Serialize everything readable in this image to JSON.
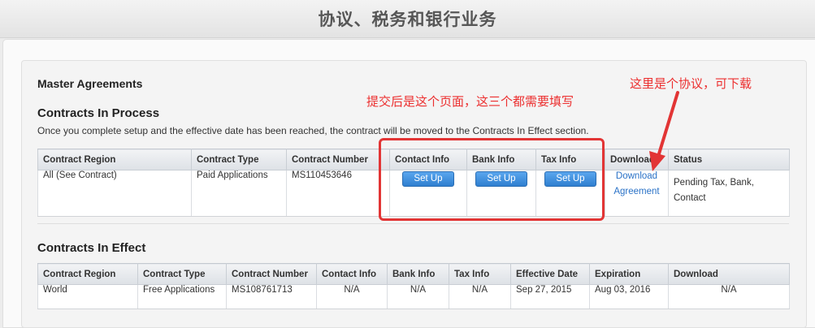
{
  "header": {
    "title": "协议、税务和银行业务"
  },
  "master": {
    "heading": "Master Agreements"
  },
  "in_process": {
    "heading": "Contracts In Process",
    "description": "Once you complete setup and the effective date has been reached, the contract will be moved to the Contracts In Effect section.",
    "columns": [
      "Contract Region",
      "Contract Type",
      "Contract Number",
      "Contact Info",
      "Bank Info",
      "Tax Info",
      "Download",
      "Status"
    ],
    "row": {
      "region": "All (See Contract)",
      "type": "Paid Applications",
      "number": "MS110453646",
      "contact_button": "Set Up",
      "bank_button": "Set Up",
      "tax_button": "Set Up",
      "download_line1": "Download",
      "download_line2": "Agreement",
      "status_line1": "Pending Tax, Bank,",
      "status_line2": "Contact"
    }
  },
  "in_effect": {
    "heading": "Contracts In Effect",
    "columns": [
      "Contract Region",
      "Contract Type",
      "Contract Number",
      "Contact Info",
      "Bank Info",
      "Tax Info",
      "Effective Date",
      "Expiration",
      "Download"
    ],
    "row": {
      "region": "World",
      "type": "Free Applications",
      "number": "MS108761713",
      "contact": "N/A",
      "bank": "N/A",
      "tax": "N/A",
      "effective": "Sep 27, 2015",
      "expiration": "Aug 03, 2016",
      "download": "N/A"
    }
  },
  "annotations": {
    "left": "提交后是这个页面，这三个都需要填写",
    "right": "这里是个协议，可下载"
  },
  "colors": {
    "annotation": "#e23535",
    "button": "#3a8ad8",
    "link": "#2a72c7"
  }
}
